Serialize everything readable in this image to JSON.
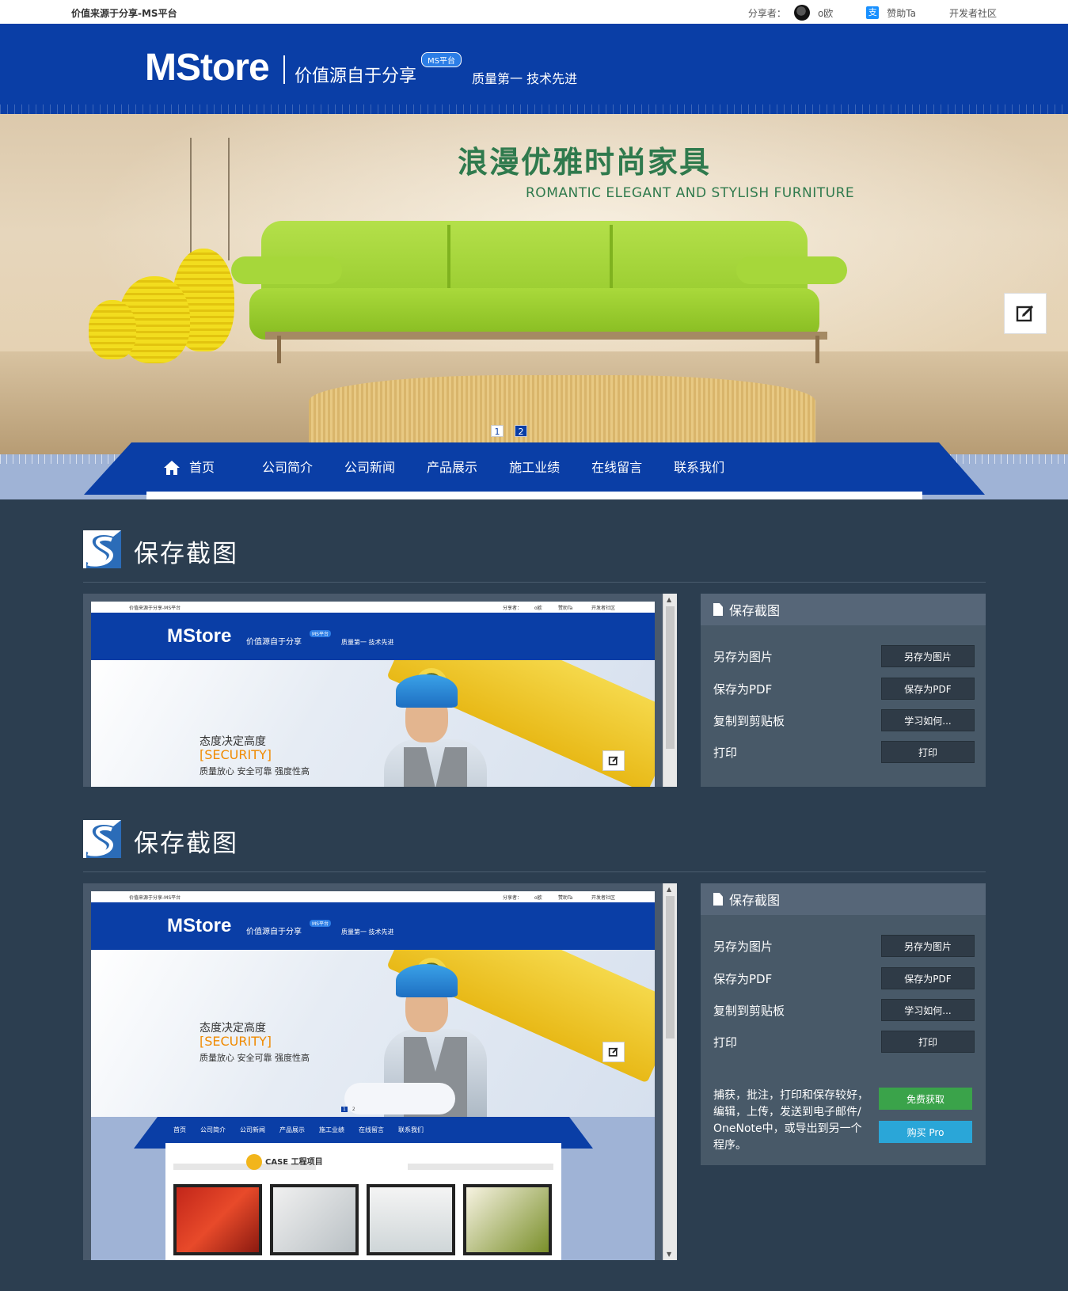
{
  "topbar": {
    "site_title": "价值来源于分享-MS平台",
    "share_label": "分享者：",
    "share_user": "o欧",
    "sponsor_icon": "支",
    "sponsor_label": "赞助Ta",
    "community_label": "开发者社区"
  },
  "header": {
    "logo": "MStore",
    "tagline": "价值源自于分享",
    "badge": "MS平台",
    "slogan": "质量第一 技术先进"
  },
  "banner": {
    "title": "浪漫优雅时尚家具",
    "subtitle": "ROMANTIC ELEGANT AND STYLISH FURNITURE",
    "pagination": [
      "1",
      "2"
    ],
    "active_page": 2
  },
  "nav": {
    "items": [
      "首页",
      "公司简介",
      "公司新闻",
      "产品展示",
      "施工业绩",
      "在线留言",
      "联系我们"
    ]
  },
  "sections": [
    {
      "title": "保存截图",
      "preview": {
        "site_title": "价值来源于分享-MS平台",
        "share": "分享者：",
        "user": "o欧",
        "sponsor": "赞助Ta",
        "community": "开发者社区",
        "logo": "MStore",
        "tagline": "价值源自于分享",
        "badge": "MS平台",
        "slogan": "质量第一 技术先进",
        "banner_line1": "态度决定高度",
        "banner_line2": "[SECURITY]",
        "banner_line3": "质量放心 安全可靠 强度性高"
      },
      "panel": {
        "header": "保存截图",
        "rows": [
          {
            "label": "另存为图片",
            "button": "另存为图片"
          },
          {
            "label": "保存为PDF",
            "button": "保存为PDF"
          },
          {
            "label": "复制到剪贴板",
            "button": "学习如何..."
          },
          {
            "label": "打印",
            "button": "打印"
          }
        ]
      }
    },
    {
      "title": "保存截图",
      "preview": {
        "site_title": "价值来源于分享-MS平台",
        "share": "分享者：",
        "user": "o欧",
        "sponsor": "赞助Ta",
        "community": "开发者社区",
        "logo": "MStore",
        "tagline": "价值源自于分享",
        "badge": "MS平台",
        "slogan": "质量第一 技术先进",
        "banner_line1": "态度决定高度",
        "banner_line2": "[SECURITY]",
        "banner_line3": "质量放心 安全可靠 强度性高",
        "nav": [
          "首页",
          "公司简介",
          "公司新闻",
          "产品展示",
          "施工业绩",
          "在线留言",
          "联系我们"
        ],
        "case_label": "CASE 工程项目",
        "pagination": [
          "1",
          "2"
        ]
      },
      "panel": {
        "header": "保存截图",
        "rows": [
          {
            "label": "另存为图片",
            "button": "另存为图片"
          },
          {
            "label": "保存为PDF",
            "button": "保存为PDF"
          },
          {
            "label": "复制到剪贴板",
            "button": "学习如何..."
          },
          {
            "label": "打印",
            "button": "打印"
          }
        ],
        "description": "捕获，批注，打印和保存较好，编辑，上传，发送到电子邮件/ OneNote中，或导出到另一个程序。",
        "free_button": "免费获取",
        "pro_button": "购买 Pro"
      }
    }
  ],
  "colors": {
    "brand_blue": "#0a3ea6",
    "page_bg": "#2c3e50",
    "panel_bg": "#485968",
    "free_green": "#3aa34a",
    "pro_blue": "#2aa6d8",
    "banner_green_text": "#2f7a4d"
  },
  "icons": [
    "avatar",
    "alipay-icon",
    "edit-icon",
    "home-icon",
    "s-logo-icon",
    "document-icon",
    "scroll-up-icon",
    "scroll-down-icon"
  ]
}
